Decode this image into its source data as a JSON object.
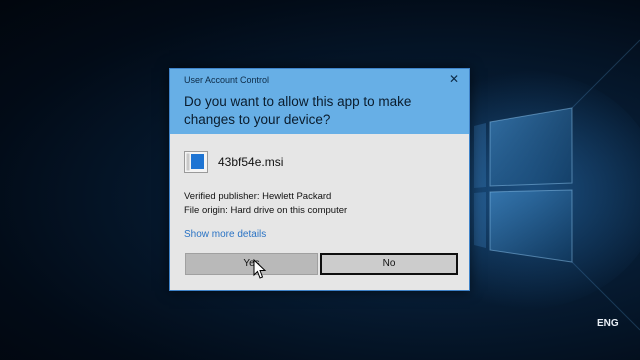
{
  "dialog": {
    "caption": "User Account Control",
    "question": "Do you want to allow this app to make changes to your device?",
    "file_name": "43bf54e.msi",
    "publisher": "Verified publisher: Hewlett Packard",
    "origin": "File origin: Hard drive on this computer",
    "more_details": "Show more details",
    "yes_label": "Yes",
    "no_label": "No",
    "close_glyph": "✕"
  },
  "taskbar": {
    "language": "ENG"
  },
  "icons": {
    "close": "close-icon",
    "file": "msi-file-icon",
    "cursor": "mouse-pointer-icon",
    "logo": "windows-logo"
  },
  "colors": {
    "header": "#67afe6",
    "dialog_bg": "#e6e6e6",
    "link": "#2a73c4",
    "desktop": "#061a30"
  }
}
